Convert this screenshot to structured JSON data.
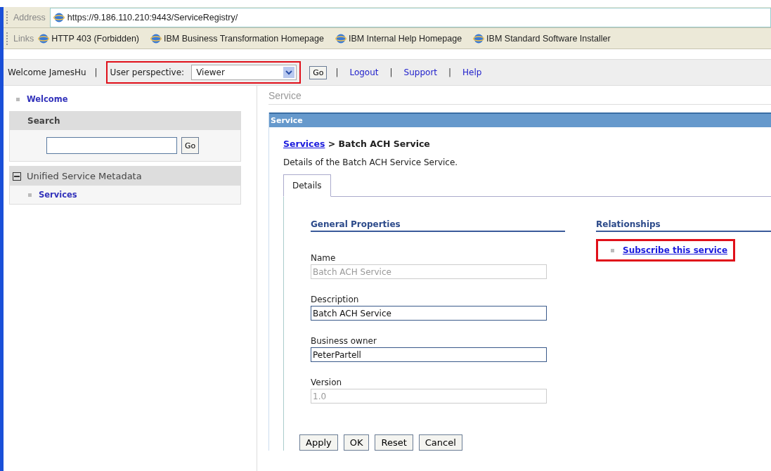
{
  "address_bar": {
    "label": "Address",
    "url": "https://9.186.110.210:9443/ServiceRegistry/"
  },
  "links_bar": {
    "label": "Links",
    "links": [
      "HTTP 403 (Forbidden)",
      "IBM Business Transformation Homepage",
      "IBM Internal Help Homepage",
      "IBM Standard Software Installer"
    ]
  },
  "top_nav": {
    "welcome": "Welcome JamesHu",
    "welcome_separator": "|",
    "perspective": {
      "label": "User perspective:",
      "value": "Viewer",
      "highlighted": true
    },
    "go": "Go",
    "links": [
      {
        "separator": "|",
        "label": "Logout"
      },
      {
        "separator": "|",
        "label": "Support"
      },
      {
        "separator": "|",
        "label": "Help"
      }
    ]
  },
  "sidebar": {
    "welcome": "Welcome",
    "search": {
      "title": "Search",
      "button": "Go"
    },
    "group": {
      "title": "Unified Service Metadata",
      "expanded": true,
      "items": [
        "Services"
      ]
    }
  },
  "main": {
    "page_title": "Service",
    "panel_title": "Service",
    "breadcrumb": {
      "link": "Services",
      "current": "> Batch ACH Service"
    },
    "description": "Details of the Batch ACH Service Service.",
    "tabs": [
      {
        "label": "Details",
        "selected": true
      }
    ],
    "general": {
      "title": "General Properties",
      "fields": [
        {
          "label": "Name",
          "value": "Batch ACH Service",
          "disabled": true
        },
        {
          "label": "Description",
          "value": "Batch ACH Service",
          "disabled": false
        },
        {
          "label": "Business owner",
          "value": "PeterPartell",
          "disabled": false
        },
        {
          "label": "Version",
          "value": "1.0",
          "disabled": true
        }
      ]
    },
    "relationships": {
      "title": "Relationships",
      "links": [
        {
          "label": "Subscribe this service",
          "highlighted": true
        }
      ]
    },
    "buttons": [
      "Apply",
      "OK",
      "Reset",
      "Cancel"
    ]
  }
}
